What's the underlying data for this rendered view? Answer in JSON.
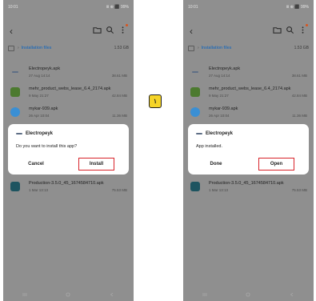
{
  "step_marker": "١",
  "screens": [
    {
      "statusbar": {
        "time": "10:01",
        "right": "Ⅲ ⊕ ⬛ 99%"
      },
      "path": {
        "label": "Installation files",
        "size": "1.53 GB"
      },
      "files": [
        {
          "name": "Electropeyk.apk",
          "date": "27 Aug 14:14",
          "size": "38.61 MB",
          "icon": "electropeyk-icon",
          "color": "#5f6f86"
        },
        {
          "name": "mehr_product_webs_lease_6.4_2174.apk",
          "date": "9 May 21:27",
          "size": "42.84 MB",
          "icon": "mehr-icon",
          "color": "#4c7a2f"
        },
        {
          "name": "mykar-939.apk",
          "date": "26 Apr 10:04",
          "size": "11.36 MB",
          "icon": "mykar-icon",
          "color": "#3a8fd4"
        },
        {
          "name": "Production-3.5.0_45_1674584710.apk",
          "date": "1 Mar 13:13",
          "size": "75.53 MB",
          "icon": "production-icon",
          "color": "#1d5460"
        }
      ],
      "dialog": {
        "app_name": "Electropeyk",
        "message": "Do you want to install this app?",
        "left_button": "Cancel",
        "right_button": "Install"
      }
    },
    {
      "statusbar": {
        "time": "10:01",
        "right": "Ⅲ ⊕ ⬛ 99%"
      },
      "path": {
        "label": "Installation files",
        "size": "1.53 GB"
      },
      "files": [
        {
          "name": "Electropeyk.apk",
          "date": "27 Aug 14:14",
          "size": "38.61 MB",
          "icon": "electropeyk-icon",
          "color": "#5f6f86"
        },
        {
          "name": "mehr_product_webs_lease_6.4_2174.apk",
          "date": "9 May 21:27",
          "size": "42.84 MB",
          "icon": "mehr-icon",
          "color": "#4c7a2f"
        },
        {
          "name": "mykar-939.apk",
          "date": "26 Apr 10:04",
          "size": "11.36 MB",
          "icon": "mykar-icon",
          "color": "#3a8fd4"
        },
        {
          "name": "Production-3.5.0_45_1674584710.apk",
          "date": "1 Mar 13:13",
          "size": "75.53 MB",
          "icon": "production-icon",
          "color": "#1d5460"
        }
      ],
      "dialog": {
        "app_name": "Electropeyk",
        "message": "App installed.",
        "left_button": "Done",
        "right_button": "Open"
      }
    }
  ]
}
